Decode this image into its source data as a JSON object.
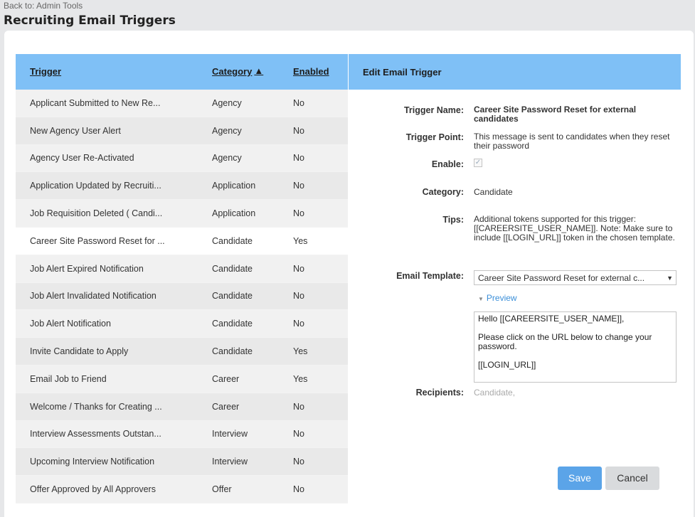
{
  "header": {
    "back_link": "Back to: Admin Tools",
    "title": "Recruiting Email Triggers"
  },
  "table": {
    "columns": {
      "trigger": "Trigger",
      "category": "Category",
      "enabled": "Enabled",
      "sort_indicator": "▲"
    },
    "rows": [
      {
        "trigger": "Applicant Submitted to New Re...",
        "category": "Agency",
        "enabled": "No"
      },
      {
        "trigger": "New Agency User Alert",
        "category": "Agency",
        "enabled": "No"
      },
      {
        "trigger": "Agency User Re-Activated",
        "category": "Agency",
        "enabled": "No"
      },
      {
        "trigger": "Application Updated by Recruiti...",
        "category": "Application",
        "enabled": "No"
      },
      {
        "trigger": "Job Requisition Deleted ( Candi...",
        "category": "Application",
        "enabled": "No"
      },
      {
        "trigger": "Career Site Password Reset for ...",
        "category": "Candidate",
        "enabled": "Yes"
      },
      {
        "trigger": "Job Alert Expired Notification",
        "category": "Candidate",
        "enabled": "No"
      },
      {
        "trigger": "Job Alert Invalidated Notification",
        "category": "Candidate",
        "enabled": "No"
      },
      {
        "trigger": "Job Alert Notification",
        "category": "Candidate",
        "enabled": "No"
      },
      {
        "trigger": "Invite Candidate to Apply",
        "category": "Candidate",
        "enabled": "Yes"
      },
      {
        "trigger": "Email Job to Friend",
        "category": "Career",
        "enabled": "Yes"
      },
      {
        "trigger": "Welcome / Thanks for Creating ...",
        "category": "Career",
        "enabled": "No"
      },
      {
        "trigger": "Interview Assessments Outstan...",
        "category": "Interview",
        "enabled": "No"
      },
      {
        "trigger": "Upcoming Interview Notification",
        "category": "Interview",
        "enabled": "No"
      },
      {
        "trigger": "Offer Approved by All Approvers",
        "category": "Offer",
        "enabled": "No"
      }
    ]
  },
  "edit_panel": {
    "title": "Edit Email Trigger",
    "labels": {
      "trigger_name": "Trigger Name:",
      "trigger_point": "Trigger Point:",
      "enable": "Enable:",
      "category": "Category:",
      "tips": "Tips:",
      "email_template": "Email Template:",
      "recipients": "Recipients:"
    },
    "trigger_name": "Career Site Password Reset for external candidates",
    "trigger_point": "This message is sent to candidates when they reset their password",
    "enable_checked": true,
    "enable_mark": "✓",
    "category": "Candidate",
    "tips": "Additional tokens supported for this trigger: [[CAREERSITE_USER_NAME]]. Note: Make sure to include [[LOGIN_URL]] token in the chosen template.",
    "email_template": "Career Site Password Reset for external c...",
    "preview_label": "Preview",
    "preview_lines": [
      "Hello [[CAREERSITE_USER_NAME]],",
      "Please click on the URL below to change your password.",
      "[[LOGIN_URL]]"
    ],
    "recipients": "Candidate,",
    "save_label": "Save",
    "cancel_label": "Cancel"
  },
  "colors": {
    "header_blue": "#7fc0f6",
    "save_blue": "#5ba4e8",
    "link_blue": "#3a8ed8"
  }
}
